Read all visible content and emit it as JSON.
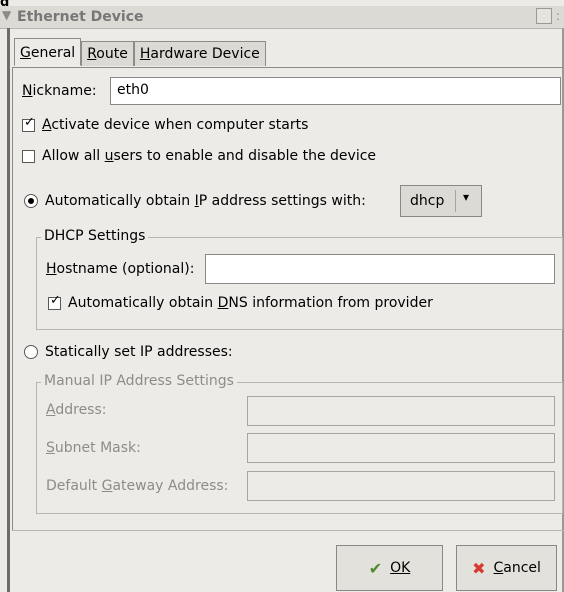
{
  "window": {
    "title": "Ethernet Device"
  },
  "tabs": [
    {
      "label": "General",
      "active": true
    },
    {
      "label": "Route",
      "active": false
    },
    {
      "label": "Hardware Device",
      "active": false
    }
  ],
  "general": {
    "nickname_label": "Nickname:",
    "nickname_value": "eth0",
    "activate_label": "Activate device when computer starts",
    "activate_checked": true,
    "allow_users_label": "Allow all users to enable and disable the device",
    "allow_users_checked": false,
    "auto_ip_label": "Automatically obtain IP address settings with:",
    "auto_ip_selected": true,
    "auto_ip_method": "dhcp",
    "dhcp_group_title": "DHCP Settings",
    "hostname_label": "Hostname (optional):",
    "hostname_value": "",
    "auto_dns_label": "Automatically obtain DNS information from provider",
    "auto_dns_checked": true,
    "static_label": "Statically set IP addresses:",
    "static_selected": false,
    "manual_group_title": "Manual IP Address Settings",
    "address_label": "Address:",
    "address_value": "",
    "subnet_label": "Subnet Mask:",
    "subnet_value": "",
    "gateway_label": "Default Gateway Address:",
    "gateway_value": ""
  },
  "buttons": {
    "ok_label": "OK",
    "cancel_label": "Cancel"
  },
  "icons": {
    "ok_icon": "checkmark-icon",
    "cancel_icon": "red-x-icon"
  },
  "colors": {
    "cancel_icon": "#d63b2f",
    "ok_icon": "#4f8a2e"
  }
}
